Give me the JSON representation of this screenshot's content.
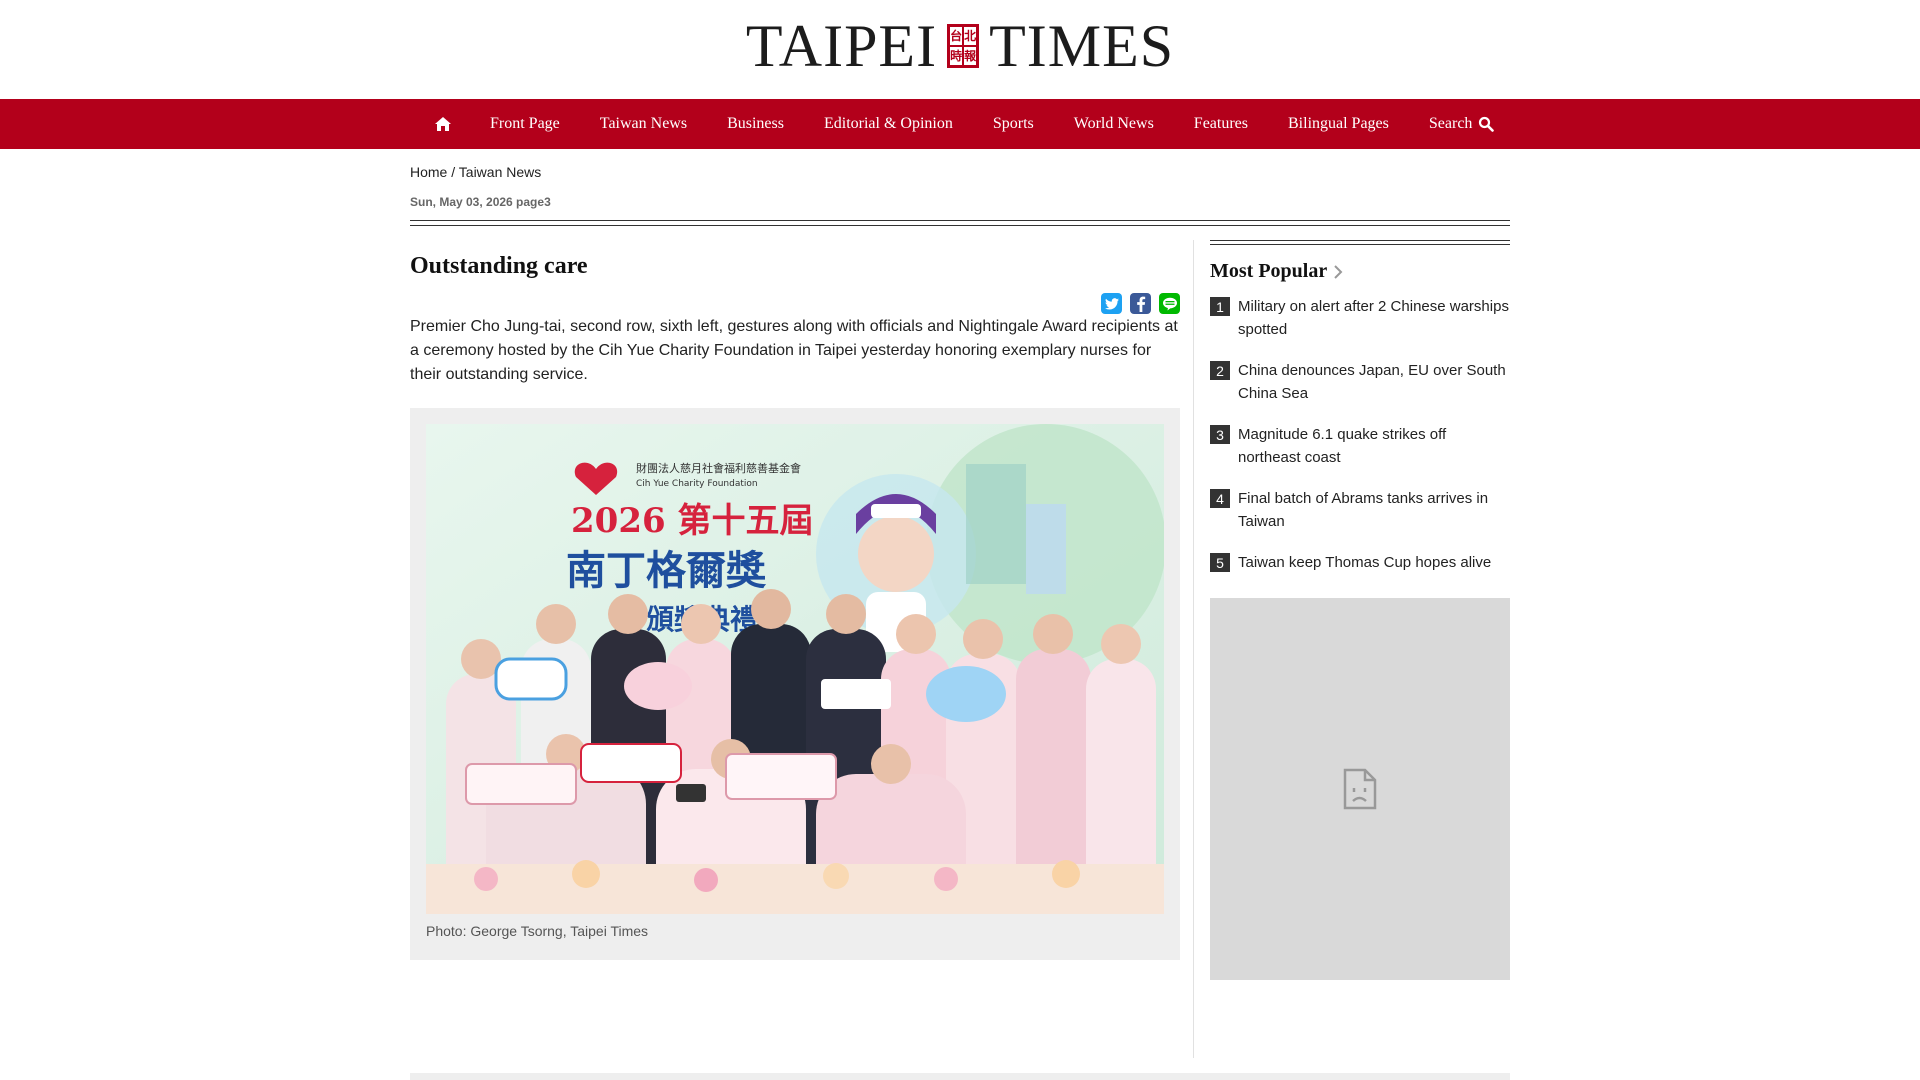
{
  "header": {
    "logo_left": "TAIPEI",
    "logo_right": "TIMES",
    "seal_chars": [
      "台",
      "北",
      "時",
      "報"
    ]
  },
  "nav": {
    "items": [
      "Front Page",
      "Taiwan News",
      "Business",
      "Editorial & Opinion",
      "Sports",
      "World News",
      "Features",
      "Bilingual Pages"
    ],
    "search_label": "Search"
  },
  "breadcrumb": {
    "home": "Home",
    "separator": "/",
    "section": "Taiwan News"
  },
  "article": {
    "date_page": "Sun, May 03, 2026 page3",
    "title": "Outstanding care",
    "caption": "Premier Cho Jung-tai, second row, sixth left, gestures along with officials and Nightingale Award recipients at a ceremony hosted by the Cih Yue Charity Foundation in Taipei yesterday honoring exemplary nurses for their outstanding service.",
    "photo_credit": "Photo: George Tsorng, Taipei Times",
    "photo_banner": {
      "org_zh": "財團法人慈月社會福利慈善基金會",
      "org_en": "Cih Yue Charity Foundation",
      "year_line": "2026 第十五屆",
      "award_line": "南丁格爾獎",
      "sub_line": "頒獎典禮"
    }
  },
  "share": {
    "twitter": "twitter-icon",
    "facebook": "facebook-icon",
    "line": "line-icon"
  },
  "sidebar": {
    "title": "Most Popular",
    "items": [
      {
        "num": "1",
        "text": "Military on alert after 2 Chinese warships spotted"
      },
      {
        "num": "2",
        "text": "China denounces Japan, EU over South China Sea"
      },
      {
        "num": "3",
        "text": "Magnitude 6.1 quake strikes off northeast coast"
      },
      {
        "num": "4",
        "text": "Final batch of Abrams tanks arrives in Taiwan"
      },
      {
        "num": "5",
        "text": "Taiwan keep Thomas Cup hopes alive"
      }
    ]
  },
  "colors": {
    "brand_red": "#b3001b",
    "twitter": "#1da1f2",
    "facebook": "#3b5998",
    "line": "#00b900"
  }
}
